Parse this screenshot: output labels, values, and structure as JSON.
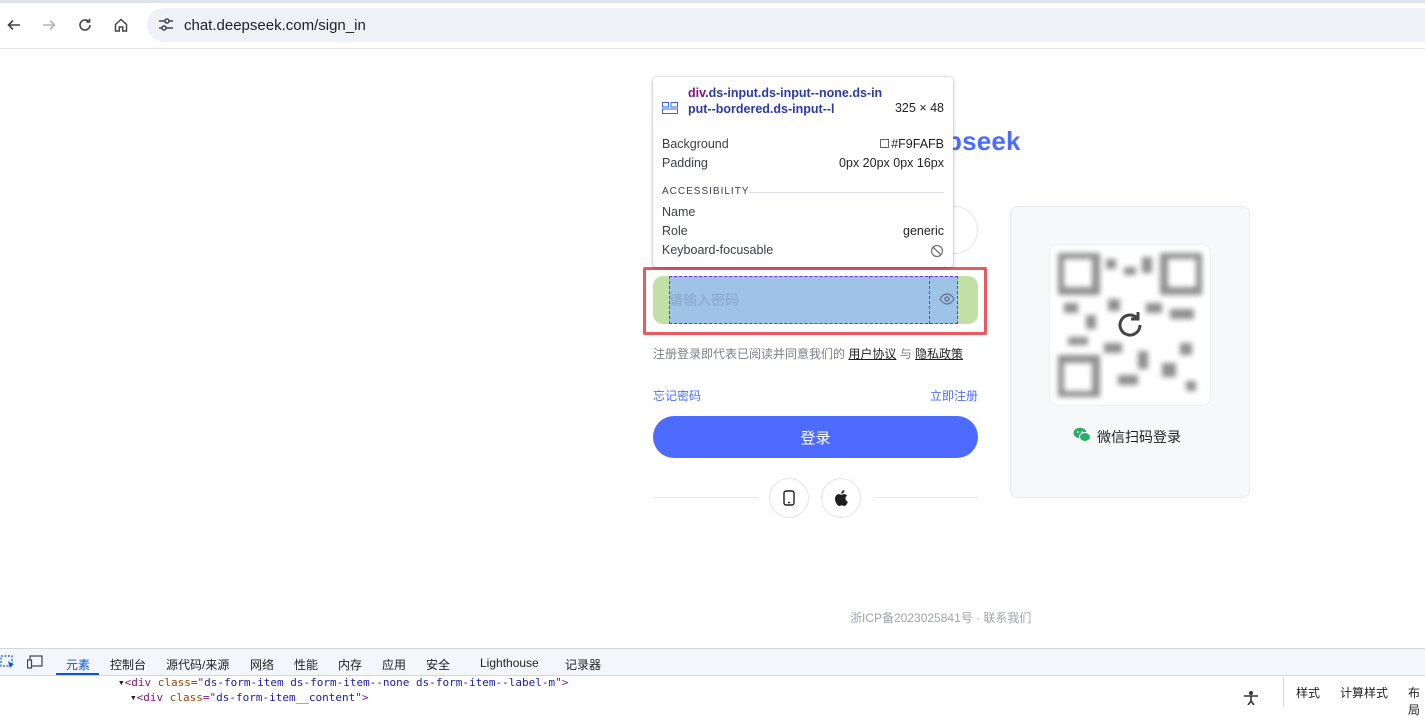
{
  "browser": {
    "url": "chat.deepseek.com/sign_in",
    "icons": [
      "back-arrow-icon",
      "forward-arrow-icon",
      "reload-icon",
      "home-icon",
      "site-settings-icon"
    ]
  },
  "page": {
    "logo_fragment": "pseek",
    "password_placeholder": "请输入密码",
    "agreement_prefix": "注册登录即代表已阅读并同意我们的 ",
    "user_agreement": "用户协议",
    "agreement_and": " 与 ",
    "privacy_policy": "隐私政策",
    "forgot_password": "忘记密码",
    "register_now": "立即注册",
    "login_button": "登录",
    "qr_label": "微信扫码登录",
    "footer": "浙ICP备2023025841号 · 联系我们",
    "colors": {
      "brand": "#4d6bfe",
      "highlight_outline": "#e85a5f"
    }
  },
  "inspect_tooltip": {
    "selector_tag": "div",
    "selector_classes": ".ds-input.ds-input--none.ds-input--bordered.ds-input--l",
    "dimensions": "325 × 48",
    "background_label": "Background",
    "background_value": "#F9FAFB",
    "padding_label": "Padding",
    "padding_value": "0px 20px 0px 16px",
    "accessibility_header": "ACCESSIBILITY",
    "name_label": "Name",
    "role_label": "Role",
    "role_value": "generic",
    "keyboard_label": "Keyboard-focusable"
  },
  "devtools": {
    "tabs": [
      "元素",
      "控制台",
      "源代码/来源",
      "网络",
      "性能",
      "内存",
      "应用",
      "安全",
      "Lighthouse",
      "记录器"
    ],
    "active_tab": "元素",
    "code_line_1": {
      "tag_open": "<div ",
      "attr": "class",
      "eq": "=\"",
      "value": "ds-form-item ds-form-item--none ds-form-item--label-m",
      "close": "\">"
    },
    "code_line_2": {
      "tag_open": "<div ",
      "attr": "class",
      "eq": "=\"",
      "value": "ds-form-item__content",
      "close": "\">"
    },
    "side_tabs": [
      "样式",
      "计算样式",
      "布局"
    ]
  }
}
